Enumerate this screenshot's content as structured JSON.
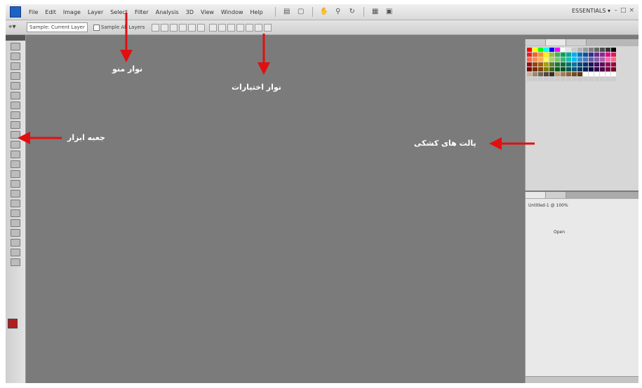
{
  "menubar": {
    "items": [
      "File",
      "Edit",
      "Image",
      "Layer",
      "Select",
      "Filter",
      "Analysis",
      "3D",
      "View",
      "Window",
      "Help"
    ],
    "workspace": "ESSENTIALS ▾"
  },
  "optionsbar": {
    "field1": "Sample: Current Layer",
    "checkbox1": "Sample All Layers"
  },
  "annotations": {
    "menubar": "نوار منو",
    "optionsbar": "نوار اختیارات",
    "toolbox": "جعبه ابزار",
    "palettes": "پالت های کشکی"
  },
  "panels": {
    "history_title": "Untitled-1 @ 100%",
    "history_item": "Open"
  },
  "colors": {
    "arrow": "#e01010",
    "foreground": "#b21f1f",
    "canvas": "#7b7b7b"
  }
}
